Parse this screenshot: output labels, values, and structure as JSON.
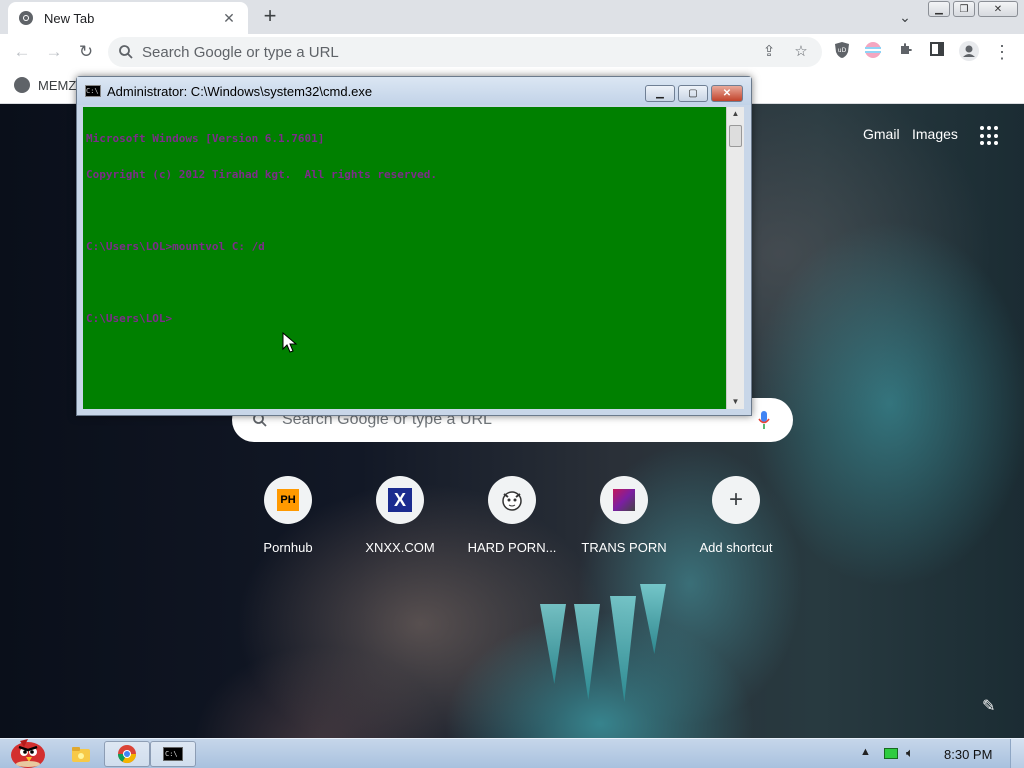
{
  "browser": {
    "tab": {
      "title": "New Tab"
    },
    "omnibox": {
      "placeholder": "Search Google or type a URL"
    },
    "bookmarks": [
      {
        "label": "MEMZ"
      }
    ]
  },
  "ntp": {
    "links": {
      "gmail": "Gmail",
      "images": "Images"
    },
    "search": {
      "placeholder": "Search Google or type a URL"
    },
    "shortcuts": [
      {
        "label": "Pornhub",
        "icon_text": "PH"
      },
      {
        "label": "XNXX.COM",
        "icon_text": "X"
      },
      {
        "label": "HARD PORN...",
        "icon_text": ""
      },
      {
        "label": "TRANS PORN",
        "icon_text": ""
      },
      {
        "label": "Add shortcut",
        "icon_text": "+"
      }
    ]
  },
  "cmd": {
    "title": "Administrator: C:\\Windows\\system32\\cmd.exe",
    "lines": [
      "Microsoft Windows [Version 6.1.7601]",
      "Copyright (c) 2012 Tirahad kgt.  All rights reserved.",
      "",
      "C:\\Users\\LOL>mountvol C: /d",
      "",
      "C:\\Users\\LOL>"
    ],
    "text_color": "#7d2c8a",
    "background_color": "#008000"
  },
  "taskbar": {
    "clock": "8:30 PM"
  }
}
